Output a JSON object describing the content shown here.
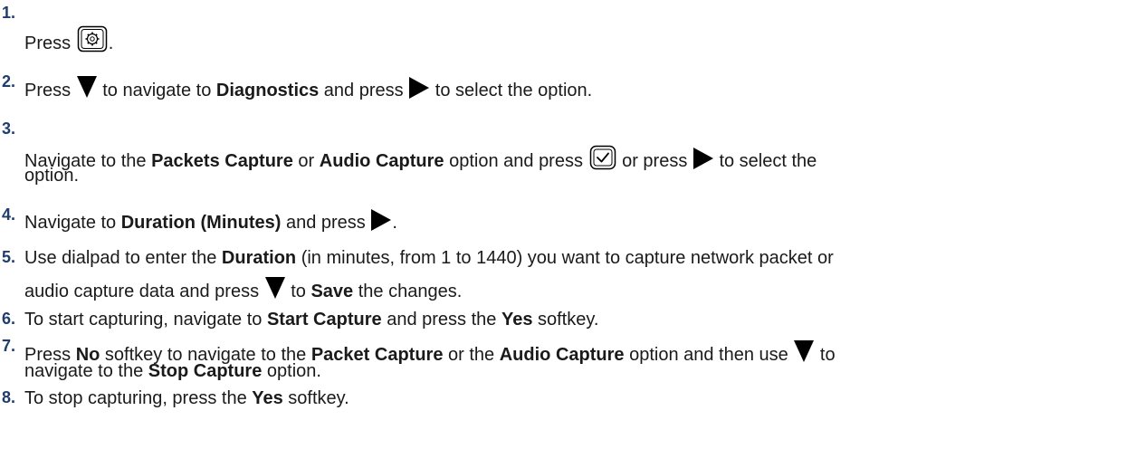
{
  "steps": [
    {
      "num": "1.",
      "parts": {
        "a": "Press ",
        "b": "."
      }
    },
    {
      "num": "2.",
      "parts": {
        "a": "Press ",
        "b": " to navigate to ",
        "c": "Diagnostics",
        "d": " and press ",
        "e": " to select the option."
      }
    },
    {
      "num": "3.",
      "parts": {
        "a": "Navigate to the ",
        "b": "Packets Capture",
        "c": " or  ",
        "d": "Audio Capture",
        "e": " option and press ",
        "f": " or press ",
        "g": " to select the",
        "h": "option."
      }
    },
    {
      "num": "4.",
      "parts": {
        "a": "Navigate to ",
        "b": "Duration (Minutes)",
        "c": " and press ",
        "d": "."
      }
    },
    {
      "num": "5.",
      "parts": {
        "a": "Use dialpad to enter the ",
        "b": "Duration",
        "c": " (in minutes, from 1 to 1440) you want to capture network packet or",
        "d": "audio capture data and press ",
        "e": " to ",
        "f": "Save",
        "g": " the changes."
      }
    },
    {
      "num": "6.",
      "parts": {
        "a": "To start capturing, navigate to ",
        "b": "Start Capture",
        "c": " and press the ",
        "d": "Yes",
        "e": " softkey."
      }
    },
    {
      "num": "7.",
      "parts": {
        "a": "Press ",
        "b": "No",
        "c": " softkey to navigate to the ",
        "d": "Packet Capture",
        "e": " or the ",
        "f": "Audio Capture",
        "g": " option and then use ",
        "h": " to",
        "i": "navigate to the ",
        "j": "Stop Capture",
        "k": " option."
      }
    },
    {
      "num": "8.",
      "parts": {
        "a": "To stop capturing, press the ",
        "b": "Yes",
        "c": " softkey."
      }
    }
  ]
}
